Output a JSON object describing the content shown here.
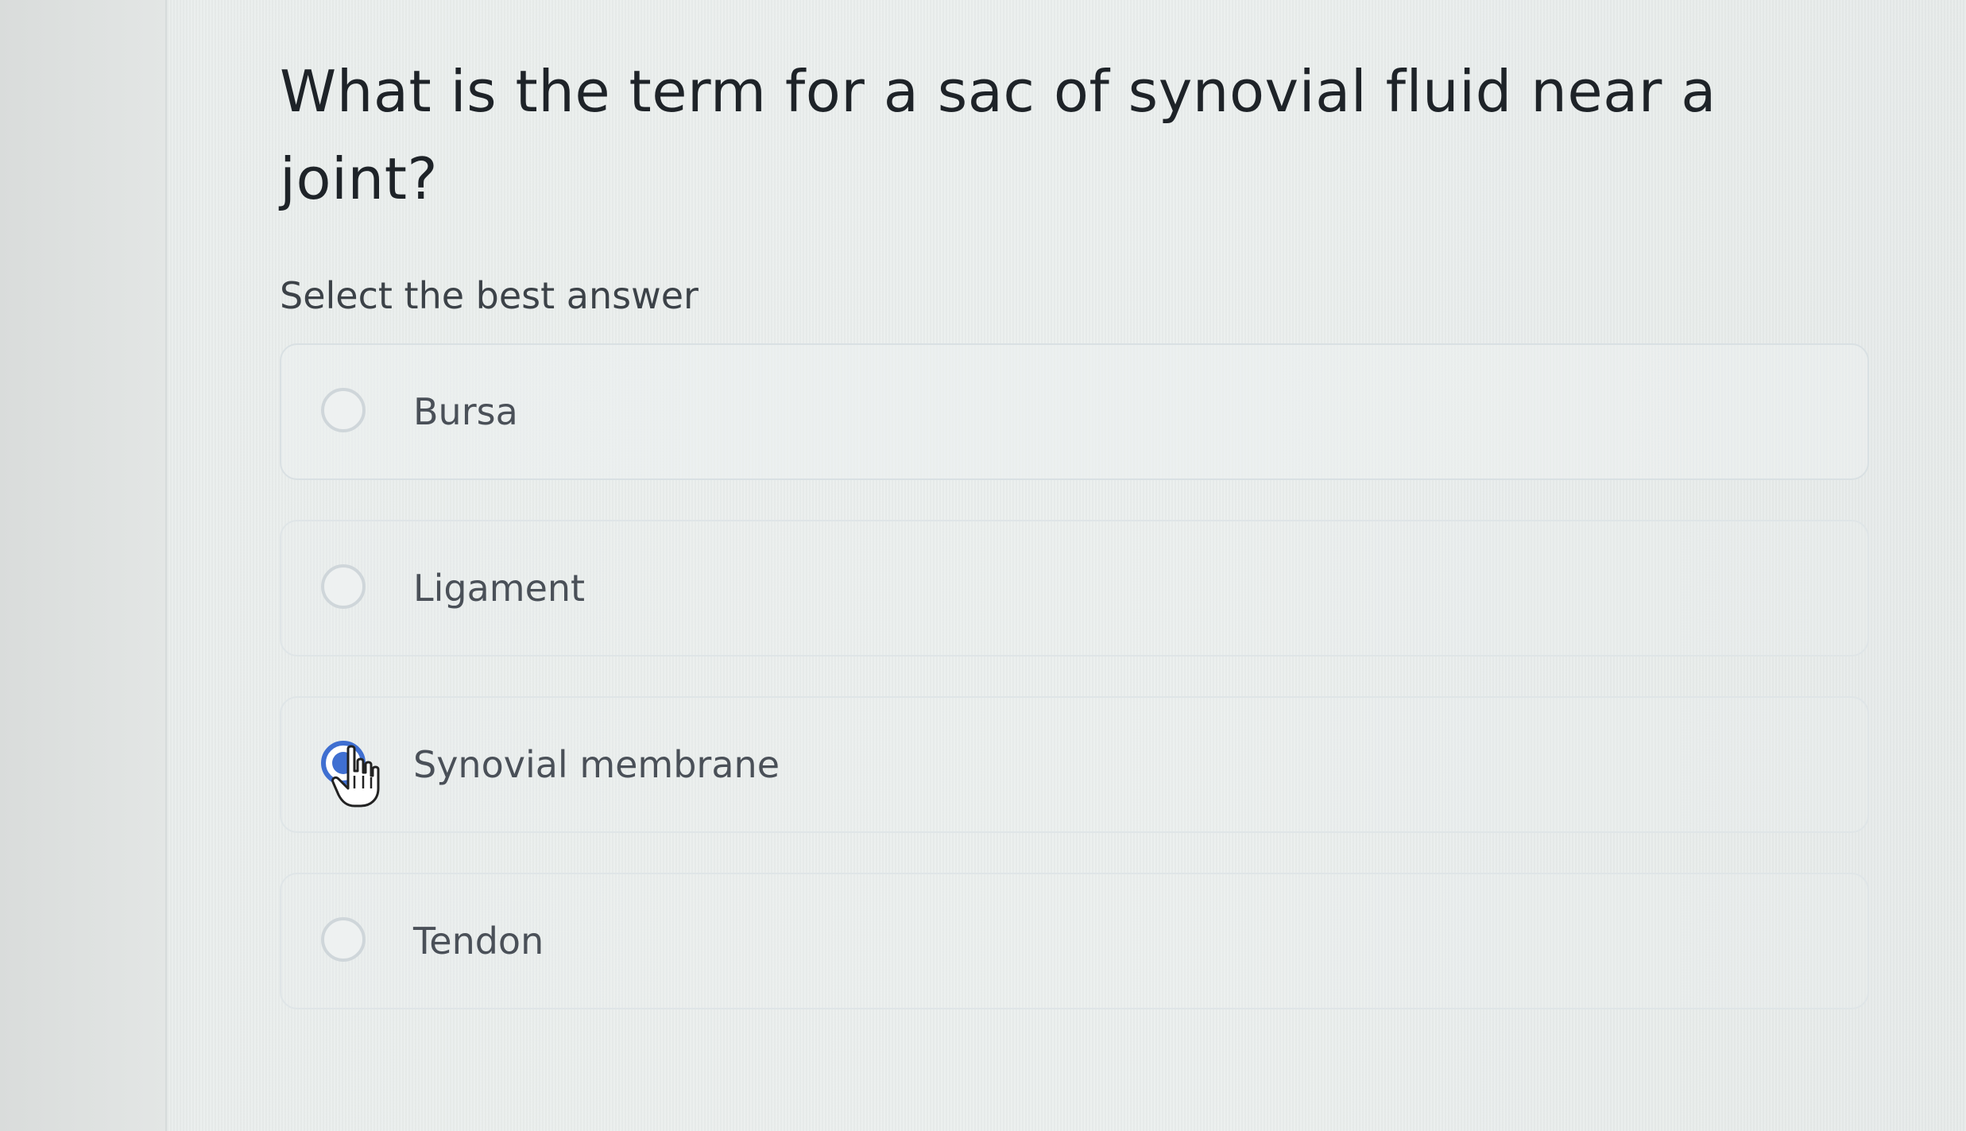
{
  "question": {
    "text": "What is the term for a sac of synovial fluid near a joint?"
  },
  "instruction": "Select the best answer",
  "options": [
    {
      "label": "Bursa",
      "selected": false
    },
    {
      "label": "Ligament",
      "selected": false
    },
    {
      "label": "Synovial membrane",
      "selected": true
    },
    {
      "label": "Tendon",
      "selected": false
    }
  ],
  "colors": {
    "accent": "#3f6fd1",
    "text_dark": "#1e2328",
    "text_option": "#4a5058"
  },
  "cursor": {
    "icon": "hand-pointer-icon"
  }
}
